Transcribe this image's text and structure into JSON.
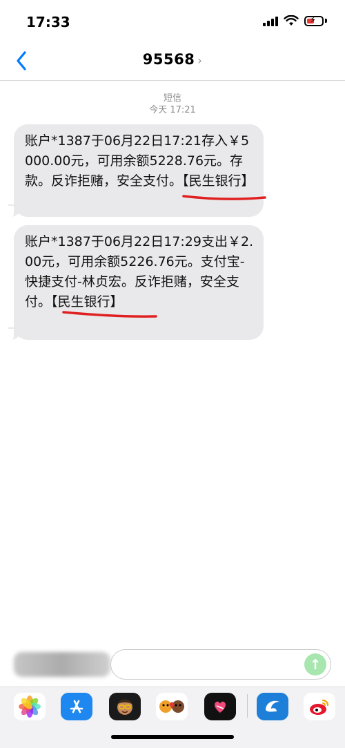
{
  "status_bar": {
    "time": "17:33"
  },
  "nav": {
    "title": "95568",
    "chevron": "›"
  },
  "thread_meta": {
    "service": "短信",
    "date": "今天 17:21"
  },
  "messages": [
    {
      "text": "账户*1387于06月22日17:21存入￥5000.00元，可用余额5228.76元。存款。反诈拒赌，安全支付。【民生银行】"
    },
    {
      "text": "账户*1387于06月22日17:29支出￥2.00元，可用余额5226.76元。支付宝-快捷支付-林贞宏。反诈拒赌，安全支付。【民生银行】"
    }
  ],
  "input": {
    "placeholder": ""
  },
  "apps": [
    "photos-icon",
    "app-store-icon",
    "memoji-icon",
    "animoji-icon",
    "digital-touch-icon",
    "dolphin-app-icon",
    "weibo-icon"
  ],
  "colors": {
    "accent": "#007aff",
    "bubble": "#e9e9eb",
    "annotation": "#e02020"
  }
}
